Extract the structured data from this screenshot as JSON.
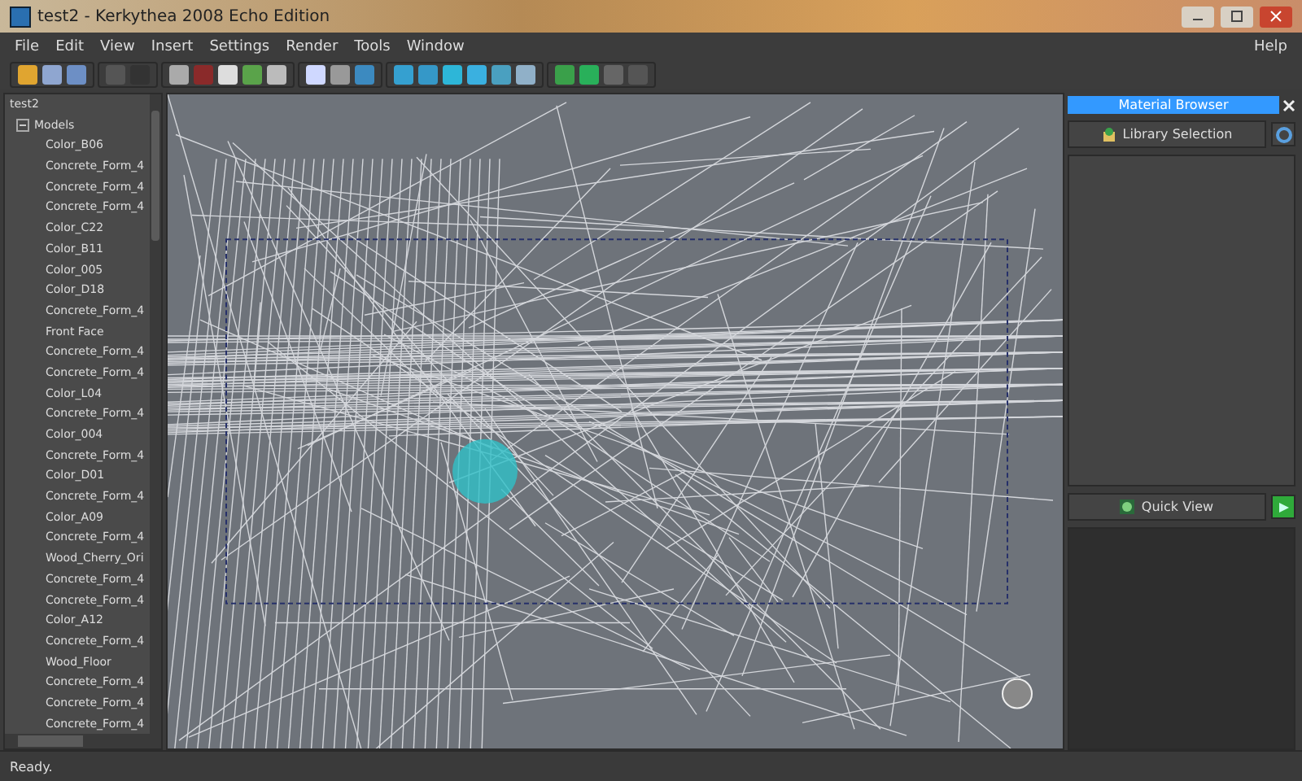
{
  "window": {
    "title": "test2 - Kerkythea 2008 Echo Edition"
  },
  "menu": [
    "File",
    "Edit",
    "View",
    "Insert",
    "Settings",
    "Render",
    "Tools",
    "Window"
  ],
  "help_menu": "Help",
  "tree": {
    "label": "test2",
    "children": [
      {
        "label": "Models",
        "expanded": true,
        "children": [
          {
            "label": "Color_B06"
          },
          {
            "label": "Concrete_Form_4"
          },
          {
            "label": "Concrete_Form_4"
          },
          {
            "label": "Concrete_Form_4"
          },
          {
            "label": "Color_C22"
          },
          {
            "label": "Color_B11"
          },
          {
            "label": "Color_005"
          },
          {
            "label": "Color_D18"
          },
          {
            "label": "Concrete_Form_4"
          },
          {
            "label": "Front Face"
          },
          {
            "label": "Concrete_Form_4"
          },
          {
            "label": "Concrete_Form_4"
          },
          {
            "label": "Color_L04"
          },
          {
            "label": "Concrete_Form_4"
          },
          {
            "label": "Color_004"
          },
          {
            "label": "Concrete_Form_4"
          },
          {
            "label": "Color_D01"
          },
          {
            "label": "Concrete_Form_4"
          },
          {
            "label": "Color_A09"
          },
          {
            "label": "Concrete_Form_4"
          },
          {
            "label": "Wood_Cherry_Ori"
          },
          {
            "label": "Concrete_Form_4"
          },
          {
            "label": "Concrete_Form_4"
          },
          {
            "label": "Color_A12"
          },
          {
            "label": "Concrete_Form_4"
          },
          {
            "label": "Wood_Floor"
          },
          {
            "label": "Concrete_Form_4"
          },
          {
            "label": "Concrete_Form_4"
          },
          {
            "label": "Concrete_Form_4"
          }
        ]
      }
    ]
  },
  "material_browser": {
    "title": "Material Browser",
    "library_button": "Library Selection",
    "quick_view_button": "Quick View"
  },
  "status_bar": "Ready."
}
